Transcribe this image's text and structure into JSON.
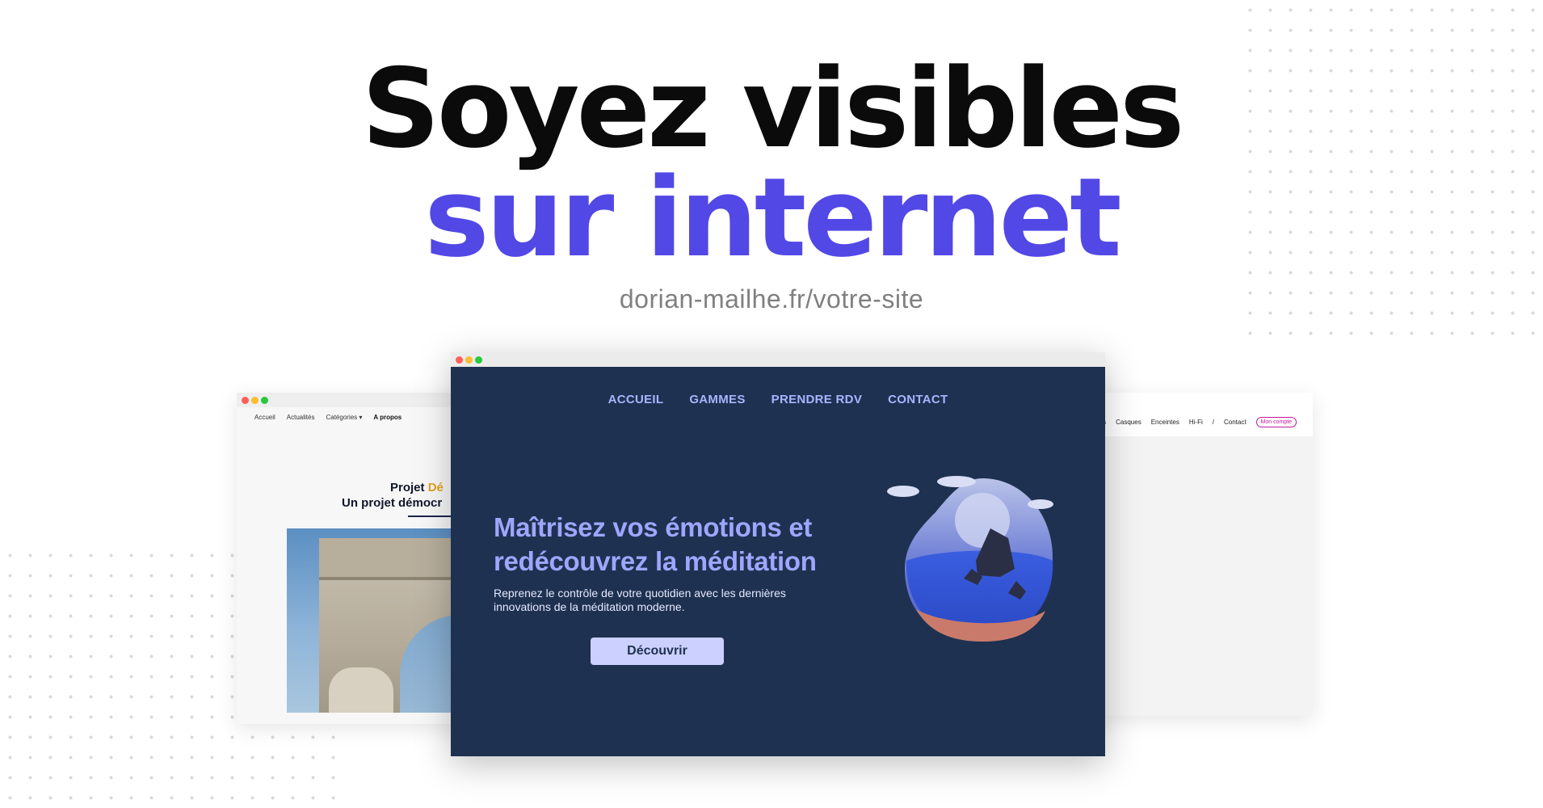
{
  "hero": {
    "line1": "Soyez visibles",
    "line2": "sur internet",
    "url": "dorian-mailhe.fr/votre-site"
  },
  "colors": {
    "accent": "#5248e6",
    "center_bg": "#1e3150",
    "center_accent": "#9ea6ff",
    "traffic_red": "#ff5f57",
    "traffic_yellow": "#febc2e",
    "traffic_green": "#28c840"
  },
  "left_site": {
    "nav": [
      "Accueil",
      "Actualités",
      "Catégories ▾",
      "A propos"
    ],
    "title_line1_a": "Projet ",
    "title_line1_b": "Dé",
    "title_line2": "Un projet démocr"
  },
  "center_site": {
    "nav": [
      "ACCUEIL",
      "GAMMES",
      "PRENDRE RDV",
      "CONTACT"
    ],
    "title": "Maîtrisez vos émotions et redécouvrez la méditation",
    "description": "Reprenez le contrôle de votre quotidien avec les dernières innovations de la méditation moderne.",
    "cta": "Découvrir",
    "illustration_icon": "meditation-island-illustration"
  },
  "right_site": {
    "nav": [
      "urs",
      "Casques",
      "Enceintes",
      "Hi-Fi",
      "/",
      "Contact"
    ],
    "account_button": "Mon compte",
    "logo_icon": "sound-wave-logo"
  }
}
